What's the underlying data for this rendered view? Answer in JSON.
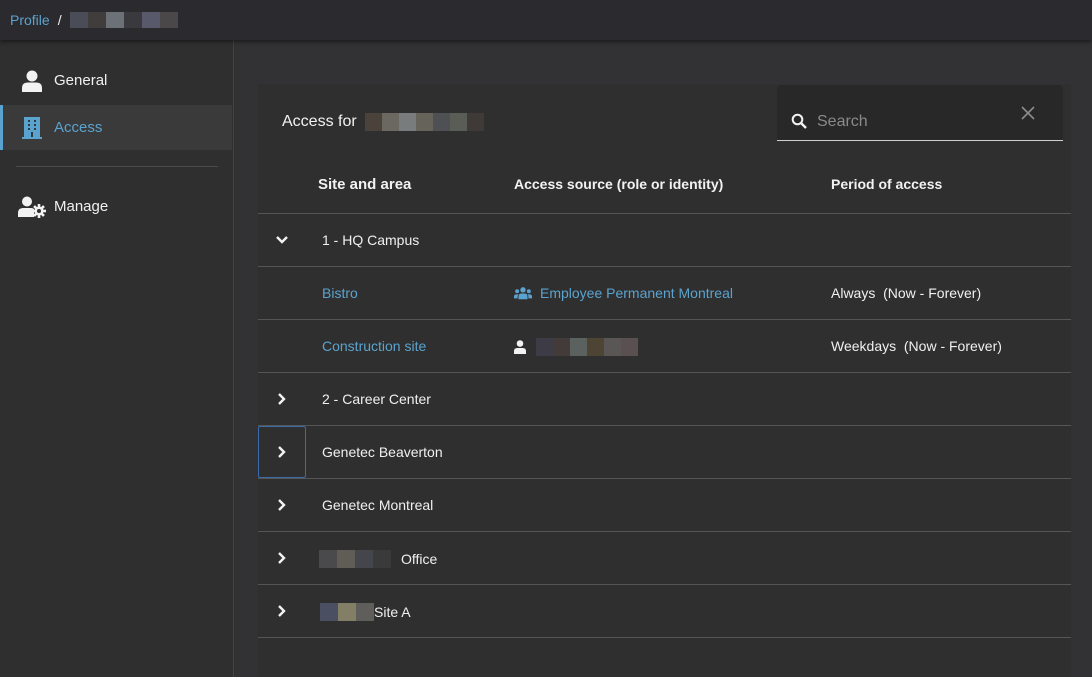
{
  "breadcrumb": {
    "root": "Profile",
    "separator": "/",
    "current_redacted": true,
    "redacted_colors": [
      "#4a4d57",
      "#403d3c",
      "#6c7177",
      "#3a3a3e",
      "#585a6c",
      "#4a4848"
    ]
  },
  "sidebar": {
    "items": [
      {
        "label": "General",
        "icon": "person-icon",
        "active": false
      },
      {
        "label": "Access",
        "icon": "building-icon",
        "active": true
      },
      {
        "label": "Manage",
        "icon": "user-gear-icon",
        "active": false
      }
    ]
  },
  "colors": {
    "accent": "#5ba3cf",
    "background": "#2f2f2f",
    "topbar": "#2b2b2f",
    "divider": "#555555",
    "focus_border": "#3d6aa8"
  },
  "panel": {
    "title": "Access for",
    "title_redacted_colors": [
      "#4a423b",
      "#6a6861",
      "#787c7d",
      "#66635b",
      "#4e5053",
      "#5a5c56",
      "#3f3a38"
    ],
    "search": {
      "placeholder": "Search",
      "value": ""
    },
    "columns": {
      "site": "Site and area",
      "source": "Access source (role or identity)",
      "period": "Period of access"
    },
    "rows": [
      {
        "type": "site",
        "expanded": true,
        "name": "1 - HQ Campus",
        "chevron": "chevron-down-icon"
      },
      {
        "type": "area",
        "name": "Bistro",
        "source_icon": "group-icon",
        "source": "Employee Permanent Montreal",
        "period": "Always  (Now - Forever)"
      },
      {
        "type": "area",
        "name": "Construction site",
        "source_icon": "person-icon",
        "source_redacted": true,
        "source_redacted_colors": [
          "#3d3c46",
          "#433a3a",
          "#5b615e",
          "#4d4434",
          "#5a5656",
          "#5a5052"
        ],
        "period": "Weekdays  (Now - Forever)"
      },
      {
        "type": "site",
        "expanded": false,
        "name": "2 - Career Center",
        "chevron": "chevron-right-icon"
      },
      {
        "type": "site",
        "expanded": false,
        "name": "Genetec Beaverton",
        "chevron": "chevron-right-icon",
        "focused": true
      },
      {
        "type": "site",
        "expanded": false,
        "name": "Genetec Montreal",
        "chevron": "chevron-right-icon"
      },
      {
        "type": "site",
        "expanded": false,
        "name": "Office",
        "name_prefix_redacted_colors": [
          "#4a4a4c",
          "#5f5d56",
          "#45464b",
          "#3a3a3a"
        ],
        "chevron": "chevron-right-icon"
      },
      {
        "type": "site",
        "expanded": false,
        "name": "Site A",
        "name_prefix_redacted_colors": [
          "#4a5061",
          "#827f66",
          "#5f5e5a"
        ],
        "chevron": "chevron-right-icon"
      }
    ]
  }
}
